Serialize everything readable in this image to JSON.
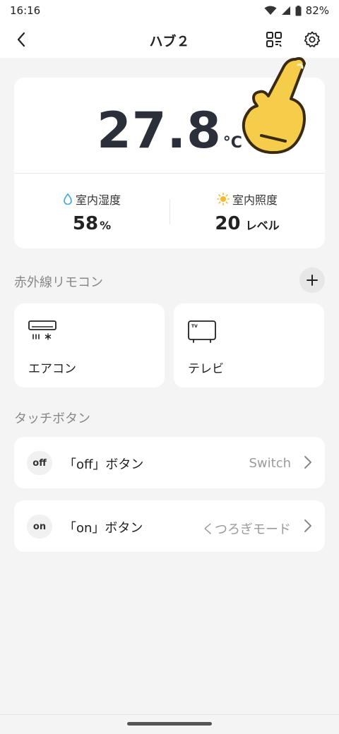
{
  "status_bar": {
    "time": "16:16",
    "battery": "82%"
  },
  "header": {
    "title": "ハブ２"
  },
  "climate": {
    "temperature": "27.8",
    "temperature_unit": "°C",
    "humidity_label": "室内湿度",
    "humidity_value": "58",
    "humidity_unit": "%",
    "light_label": "室内照度",
    "light_value": "20",
    "light_unit": "レベル"
  },
  "ir_section": {
    "title": "赤外線リモコン",
    "devices": [
      {
        "label": "エアコン",
        "icon": "air-conditioner-icon"
      },
      {
        "label": "テレビ",
        "icon": "tv-icon"
      }
    ]
  },
  "touch_section": {
    "title": "タッチボタン",
    "buttons": [
      {
        "badge": "off",
        "name": "「off」ボタン",
        "action": "Switch"
      },
      {
        "badge": "on",
        "name": "「on」ボタン",
        "action": "くつろぎモード"
      }
    ]
  },
  "colors": {
    "accent_hand": "#f6cd4a",
    "water_icon": "#3aa6e0",
    "sun_icon": "#f5b82e"
  }
}
